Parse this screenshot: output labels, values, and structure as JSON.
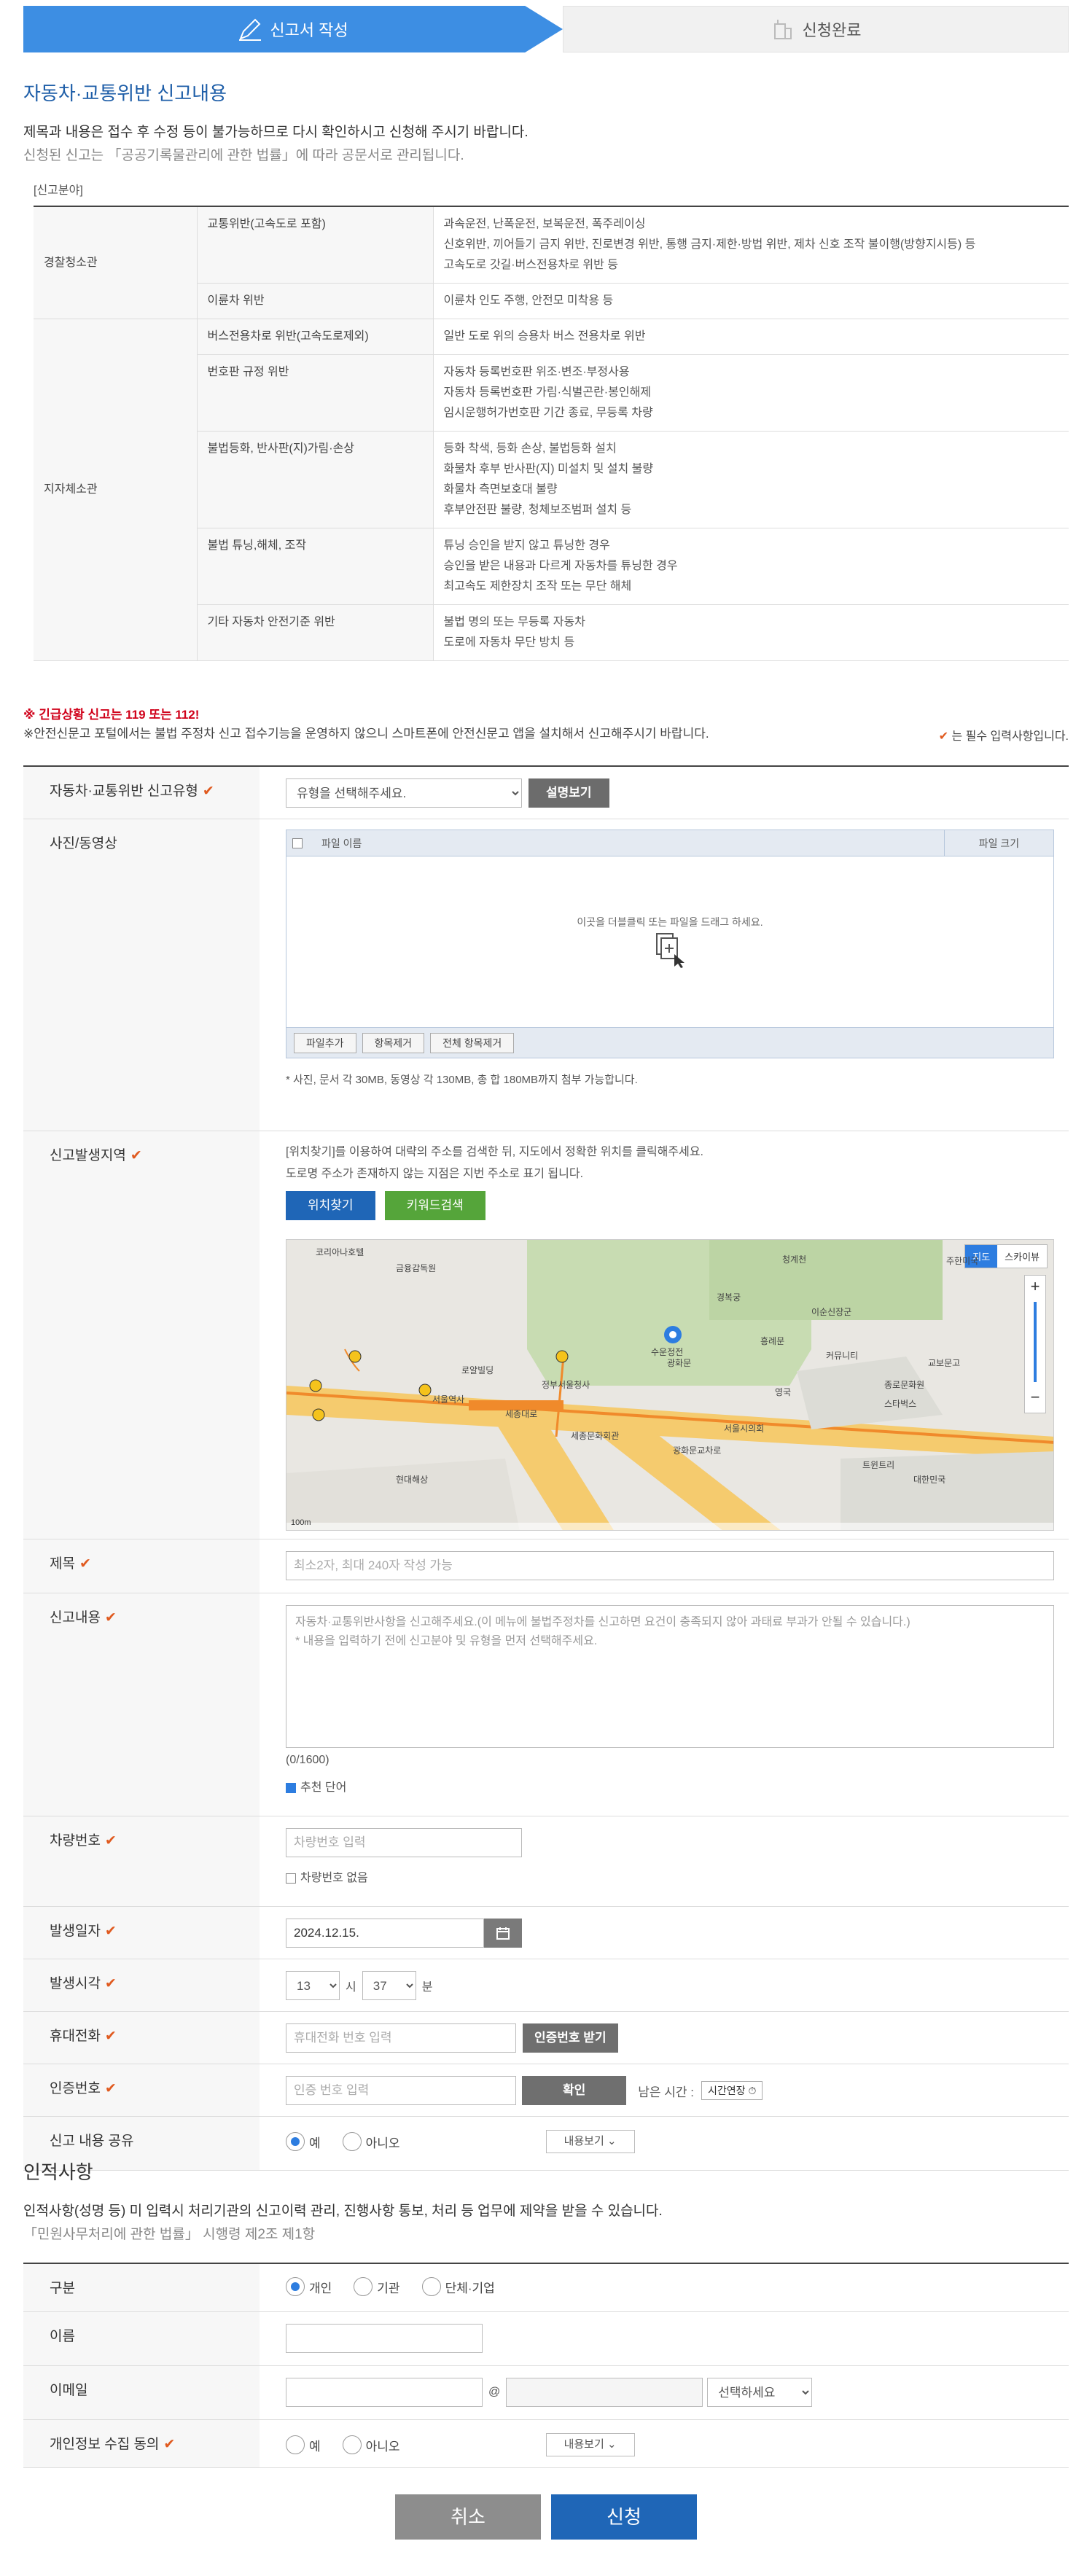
{
  "steps": [
    {
      "label": "신고서 작성"
    },
    {
      "label": "신청완료"
    }
  ],
  "section1": {
    "title": "자동차·교통위반 신고내용",
    "notice1": "제목과 내용은 접수 후 수정 등이 불가능하므로 다시 확인하시고 신청해 주시기 바랍니다.",
    "notice2": "신청된 신고는 「공공기록물관리에 관한 법률」에 따라 공문서로 관리됩니다."
  },
  "category_label": "[신고분야]",
  "categories": {
    "police": "경찰청소관",
    "local": "지자체소관",
    "rows": [
      {
        "name": "교통위반(고속도로 포함)",
        "desc": [
          "과속운전, 난폭운전, 보복운전, 폭주레이싱",
          "신호위반, 끼어들기 금지 위반, 진로변경 위반, 통행 금지·제한·방법 위반, 제차 신호 조작 불이행(방향지시등) 등",
          "고속도로 갓길·버스전용차로 위반 등"
        ]
      },
      {
        "name": "이륜차 위반",
        "desc": [
          "이륜차 인도 주행, 안전모 미착용 등"
        ]
      },
      {
        "name": "버스전용차로 위반(고속도로제외)",
        "desc": [
          "일반 도로 위의 승용차 버스 전용차로 위반"
        ]
      },
      {
        "name": "번호판 규정 위반",
        "desc": [
          "자동차 등록번호판 위조·변조·부정사용",
          "자동차 등록번호판 가림·식별곤란·봉인해제",
          "임시운행허가번호판 기간 종료, 무등록 차량"
        ]
      },
      {
        "name": "불법등화, 반사판(지)가림·손상",
        "desc": [
          "등화 착색, 등화 손상, 불법등화 설치",
          "화물차 후부 반사판(지) 미설치 및 설치 불량",
          "화물차 측면보호대 불량",
          "후부안전판 불량, 청체보조범퍼 설치 등"
        ]
      },
      {
        "name": "불법 튜닝,해체, 조작",
        "desc": [
          "튜닝 승인을 받지 않고 튜닝한 경우",
          "승인을 받은 내용과 다르게 자동차를 튜닝한 경우",
          "최고속도 제한장치 조작 또는 무단 해체"
        ]
      },
      {
        "name": "기타 자동차 안전기준 위반",
        "desc": [
          "불법 명의 또는 무등록 자동차",
          "도로에 자동차 무단 방치 등"
        ]
      }
    ]
  },
  "warnings": {
    "emergency": "※ 긴급상황 신고는 119 또는 112!",
    "app": "※안전신문고 포털에서는 불법 주정차 신고 접수기능을 운영하지 않으니 스마트폰에 안전신문고 앱을 설치해서 신고해주시기 바랍니다.",
    "required": "는 필수 입력사항입니다."
  },
  "form": {
    "type": {
      "label": "자동차·교통위반 신고유형",
      "placeholder": "유형을 선택해주세요.",
      "help_button": "설명보기"
    },
    "media": {
      "label": "사진/동영상",
      "col_name": "파일 이름",
      "col_size": "파일 크기",
      "drop_text": "이곳을 더블클릭 또는 파일을 드래그 하세요.",
      "add": "파일추가",
      "remove": "항목제거",
      "remove_all": "전체 항목제거",
      "note": "* 사진,    문서 각 30MB, 동영상 각 130MB, 총 합 180MB까지 첨부 가능합니다."
    },
    "location": {
      "label": "신고발생지역",
      "help1": "[위치찾기]를 이용하여 대략의 주소를 검색한 뒤, 지도에서 정확한 위치를 클릭해주세요.",
      "help2": "도로명 주소가 존재하지 않는 지점은 지번 주소로 표기 됩니다.",
      "find_button": "위치찾기",
      "keyword_button": "키워드검색",
      "map_tab": "지도",
      "sky_tab": "스카이뷰",
      "map_labels": [
        "코리아나호텔",
        "금융감독원",
        "서울역사",
        "광화문",
        "세종대로",
        "경복궁",
        "수운정전",
        "스타벅스",
        "종로문화원",
        "청계천",
        "정부서울청사",
        "현대해상",
        "이순신장군",
        "서울시의회",
        "트윈트리",
        "교보문고",
        "광화문교차로",
        "세종문화회관",
        "흥례문",
        "대한민국",
        "주한미국",
        "커뮤니티",
        "영국",
        "로얄빌딩"
      ],
      "scale": "100m"
    },
    "title": {
      "label": "제목",
      "placeholder": "최소2자, 최대 240자 작성 가능"
    },
    "content": {
      "label": "신고내용",
      "placeholder1": "자동차·교통위반사항을 신고해주세요.(이 메뉴에 불법주정차를 신고하면 요건이 충족되지 않아 과태료 부과가 안될 수 있습니다.)",
      "placeholder2": "* 내용을 입력하기 전에 신고분야 및 유형을 먼저 선택해주세요.",
      "count": "(0/1600)",
      "recommend": "추천 단어"
    },
    "vehicle": {
      "label": "차량번호",
      "placeholder": "차량번호 입력",
      "none": "차량번호 없음"
    },
    "date": {
      "label": "발생일자",
      "value": "2024.12.15."
    },
    "time": {
      "label": "발생시각",
      "hour": "13",
      "hour_unit": "시",
      "minute": "37",
      "minute_unit": "분"
    },
    "phone": {
      "label": "휴대전화",
      "placeholder": "휴대전화 번호 입력",
      "button": "인증번호 받기"
    },
    "auth": {
      "label": "인증번호",
      "placeholder": "인증 번호 입력",
      "button": "확인",
      "remaining": "남은 시간 :",
      "extend": "시간연장"
    },
    "share": {
      "label": "신고 내용 공유",
      "yes": "예",
      "no": "아니오",
      "more": "내용보기"
    }
  },
  "section2": {
    "title": "인적사항",
    "notice1": "인적사항(성명 등) 미 입력시 처리기관의 신고이력 관리, 진행사항 통보, 처리 등 업무에 제약을 받을 수 있습니다.",
    "notice2": "「민원사무처리에 관한 법률」 시행령 제2조 제1항"
  },
  "person": {
    "type": {
      "label": "구분",
      "opt1": "개인",
      "opt2": "기관",
      "opt3": "단체·기업"
    },
    "name": {
      "label": "이름"
    },
    "email": {
      "label": "이메일",
      "at": "@",
      "domain_placeholder": "선택하세요"
    },
    "consent": {
      "label": "개인정보 수집 동의",
      "yes": "예",
      "no": "아니오",
      "more": "내용보기"
    }
  },
  "buttons": {
    "cancel": "취소",
    "submit": "신청"
  },
  "colors": {
    "primary": "#3d8ee3",
    "title": "#1e5ea8",
    "check": "#e05a1f",
    "cancel": "#8d8d8d",
    "submit": "#1f66b7"
  }
}
